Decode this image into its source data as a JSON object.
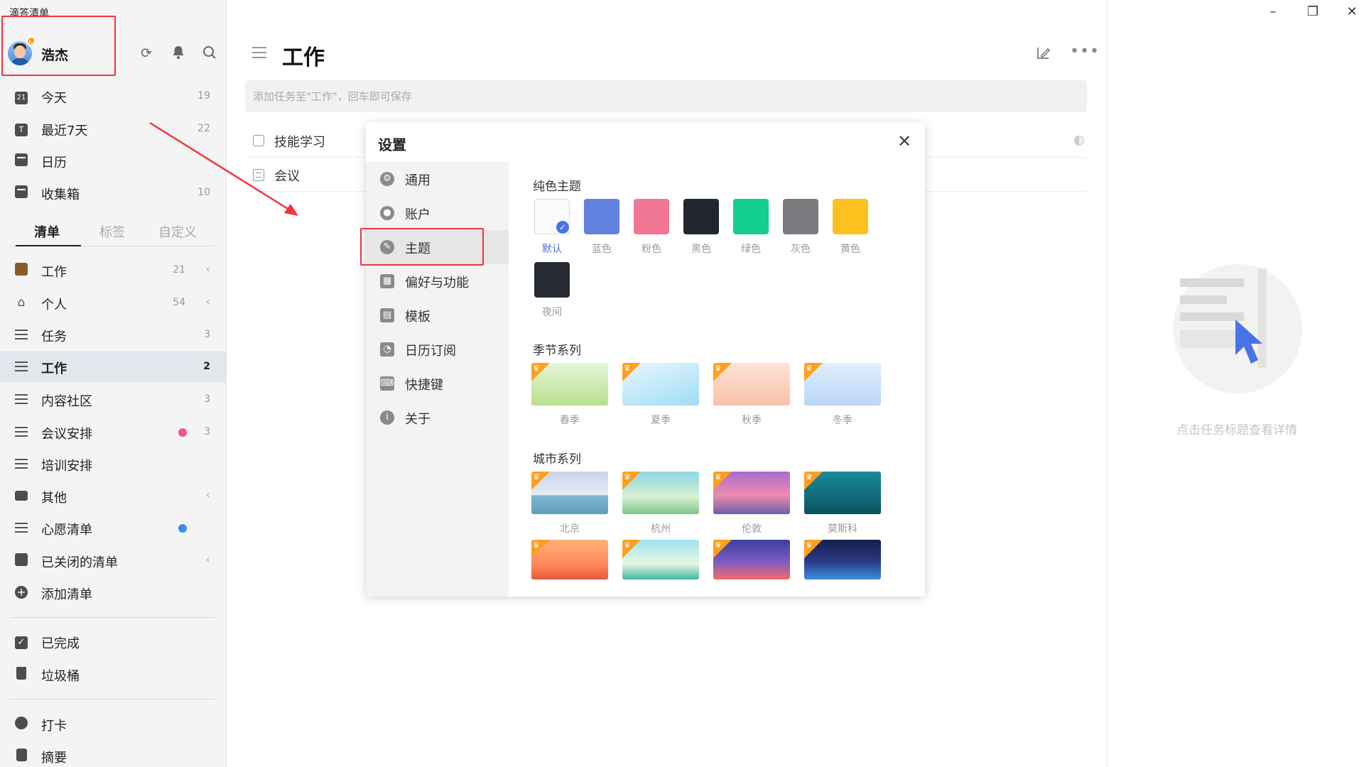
{
  "app": {
    "title": "滴答清单"
  },
  "user": {
    "name": "浩杰"
  },
  "smart_lists": [
    {
      "label": "今天",
      "count": "19"
    },
    {
      "label": "最近7天",
      "count": "22"
    },
    {
      "label": "日历",
      "count": ""
    },
    {
      "label": "收集箱",
      "count": "10"
    }
  ],
  "sidebar_tabs": [
    "清单",
    "标签",
    "自定义"
  ],
  "lists": [
    {
      "label": "工作",
      "count": "21",
      "chevron": "‹"
    },
    {
      "label": "个人",
      "count": "54",
      "chevron": "‹"
    },
    {
      "label": "任务",
      "count": "3"
    },
    {
      "label": "工作",
      "count": "2"
    },
    {
      "label": "内容社区",
      "count": "3"
    },
    {
      "label": "会议安排",
      "count": "3",
      "dot_color": "#f0567b"
    },
    {
      "label": "培训安排",
      "count": ""
    },
    {
      "label": "其他",
      "count": "",
      "chevron": "‹"
    },
    {
      "label": "心愿清单",
      "count": "",
      "dot_color": "#3d8df0"
    },
    {
      "label": "已关闭的清单",
      "count": "",
      "chevron": "‹"
    },
    {
      "label": "添加清单",
      "count": ""
    }
  ],
  "bottom_items": [
    {
      "label": "已完成"
    },
    {
      "label": "垃圾桶"
    },
    {
      "label": "打卡"
    },
    {
      "label": "摘要"
    }
  ],
  "main": {
    "title": "工作",
    "add_placeholder": "添加任务至\"工作\"，回车即可保存",
    "tasks": [
      {
        "title": "技能学习"
      },
      {
        "title": "会议"
      }
    ]
  },
  "detail": {
    "empty_text": "点击任务标题查看详情"
  },
  "window_controls": {
    "minimize": "–",
    "restore": "❐",
    "close": "✕"
  },
  "settings": {
    "title": "设置",
    "close": "✕",
    "nav": [
      {
        "label": "通用",
        "icon": "gear-icon"
      },
      {
        "label": "账户",
        "icon": "user-icon"
      },
      {
        "label": "主题",
        "icon": "theme-icon"
      },
      {
        "label": "偏好与功能",
        "icon": "grid-icon"
      },
      {
        "label": "模板",
        "icon": "template-icon"
      },
      {
        "label": "日历订阅",
        "icon": "rss-icon"
      },
      {
        "label": "快捷键",
        "icon": "keyboard-icon"
      },
      {
        "label": "关于",
        "icon": "info-icon"
      }
    ],
    "selected": "主题",
    "solid_section": "纯色主题",
    "solid_themes": [
      {
        "label": "默认",
        "color": "#fafafa",
        "selected": true
      },
      {
        "label": "蓝色",
        "color": "#6381de"
      },
      {
        "label": "粉色",
        "color": "#f27795"
      },
      {
        "label": "黑色",
        "color": "#22262f"
      },
      {
        "label": "绿色",
        "color": "#14ce8f"
      },
      {
        "label": "灰色",
        "color": "#7b7b80"
      },
      {
        "label": "黄色",
        "color": "#fbc11f"
      },
      {
        "label": "夜间",
        "color": "#272b34"
      }
    ],
    "season_section": "季节系列",
    "season_themes": [
      {
        "label": "春季"
      },
      {
        "label": "夏季"
      },
      {
        "label": "秋季"
      },
      {
        "label": "冬季"
      }
    ],
    "city_section": "城市系列",
    "city_themes": [
      {
        "label": "北京"
      },
      {
        "label": "杭州"
      },
      {
        "label": "伦敦"
      },
      {
        "label": "莫斯科"
      },
      {
        "label": ""
      },
      {
        "label": ""
      },
      {
        "label": ""
      },
      {
        "label": ""
      }
    ]
  }
}
